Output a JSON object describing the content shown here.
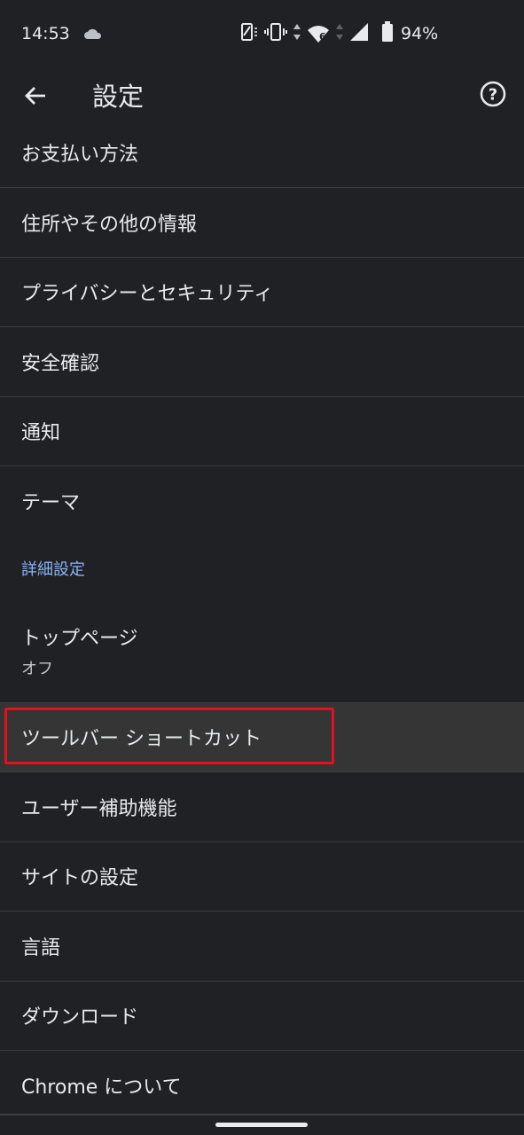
{
  "status_bar": {
    "time": "14:53",
    "battery": "94%",
    "network_badge": "6"
  },
  "app_bar": {
    "title": "設定"
  },
  "items": [
    {
      "label": "お支払い方法"
    },
    {
      "label": "住所やその他の情報"
    },
    {
      "label": "プライバシーとセキュリティ"
    },
    {
      "label": "安全確認"
    },
    {
      "label": "通知"
    },
    {
      "label": "テーマ"
    }
  ],
  "section_header": "詳細設定",
  "homepage": {
    "label": "トップページ",
    "subtitle": "オフ"
  },
  "toolbar_shortcut": {
    "label": "ツールバー ショートカット"
  },
  "items2": [
    {
      "label": "ユーザー補助機能"
    },
    {
      "label": "サイトの設定"
    },
    {
      "label": "言語"
    },
    {
      "label": "ダウンロード"
    },
    {
      "label": "Chrome について"
    }
  ],
  "colors": {
    "background": "#202124",
    "accent": "#8ab4f8",
    "highlight_box": "#e3101e"
  },
  "icons": [
    "cloud-icon",
    "rotate-icon",
    "vibrate-icon",
    "data-arrows-icon",
    "wifi-icon",
    "signal-icon",
    "battery-icon",
    "back-arrow-icon",
    "help-icon"
  ]
}
